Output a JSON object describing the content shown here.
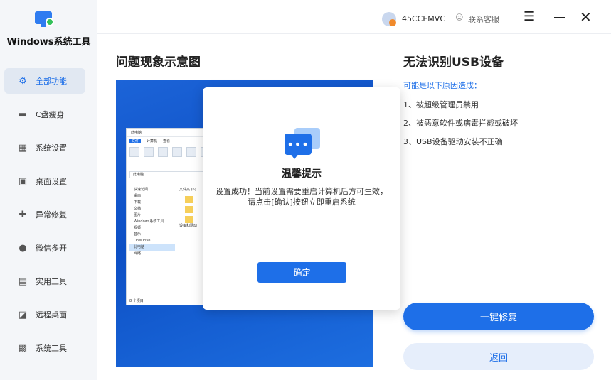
{
  "app": {
    "title": "Windows系统工具"
  },
  "sidebar": {
    "items": [
      {
        "label": "全部功能",
        "icon": "gear-icon",
        "active": true
      },
      {
        "label": "C盘瘦身",
        "icon": "drive-icon"
      },
      {
        "label": "系统设置",
        "icon": "grid-icon"
      },
      {
        "label": "桌面设置",
        "icon": "monitor-icon"
      },
      {
        "label": "异常修复",
        "icon": "wrench-icon"
      },
      {
        "label": "微信多开",
        "icon": "chat-icon"
      },
      {
        "label": "实用工具",
        "icon": "toolbox-icon"
      },
      {
        "label": "远程桌面",
        "icon": "remote-icon"
      },
      {
        "label": "系统工具",
        "icon": "briefcase-icon"
      }
    ]
  },
  "topbar": {
    "user_name": "45CCEMVC",
    "support_label": "联系客服"
  },
  "main": {
    "preview_title": "问题现象示意图",
    "issue_title": "无法识别USB设备",
    "reasons_header": "可能是以下原因造成：",
    "reasons": [
      "1、被超级管理员禁用",
      "2、被恶意软件或病毒拦截或破坏",
      "3、USB设备驱动安装不正确"
    ],
    "primary_button": "一键修复",
    "secondary_button": "返回"
  },
  "explorer": {
    "title": "此电脑",
    "tabs": [
      "文件",
      "计算机",
      "查看"
    ],
    "address": "此电脑",
    "sidebar": [
      "快速访问",
      "桌面",
      "下载",
      "文档",
      "图片",
      "Windows系统工具",
      "视频",
      "音乐",
      "OneDrive",
      "此电脑",
      "网络"
    ],
    "files_header": "文件夹 (6)",
    "devices_header": "设备和驱动",
    "status": "8 个项目"
  },
  "dialog": {
    "title": "温馨提示",
    "message": "设置成功！当前设置需要重启计算机后方可生效，请点击[确认]按钮立即重启系统",
    "confirm_button": "确定"
  },
  "colors": {
    "accent": "#1e6fe8",
    "sidebar_bg": "#f4f6f9",
    "active_item_bg": "#e1e8f2",
    "preview_blue": "#1c64d8"
  }
}
